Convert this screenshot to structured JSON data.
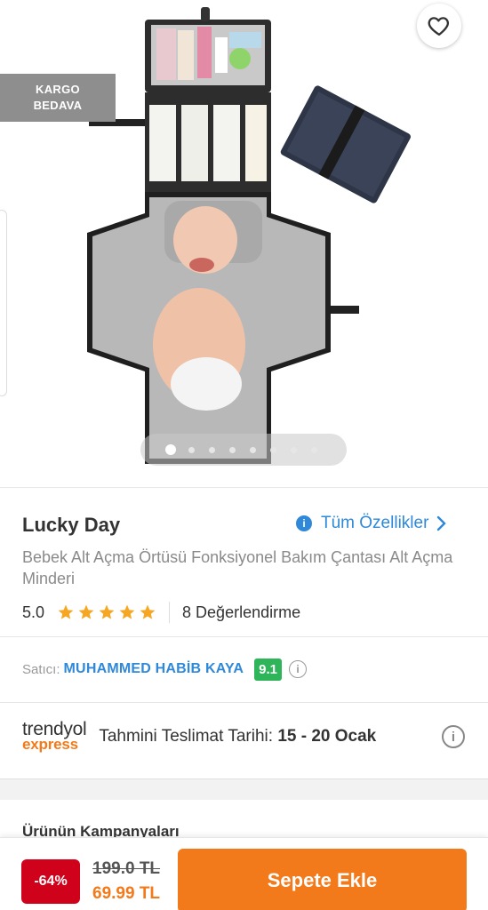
{
  "hero": {
    "cargo_badge": [
      "KARGO",
      "BEDAVA"
    ],
    "gallery": {
      "total_images": 8,
      "active_index": 0
    },
    "icons": {
      "back": "arrow-left-icon",
      "share": "share-icon",
      "favorite": "heart-icon"
    }
  },
  "product": {
    "brand": "Lucky Day",
    "all_features_label": "Tüm Özellikler",
    "title": "Bebek Alt Açma Örtüsü Fonksiyonel Bakım Çantası Alt Açma Minderi",
    "rating": "5.0",
    "stars": 5,
    "review_count": "8 Değerlendirme"
  },
  "seller": {
    "label": "Satıcı:",
    "name": "MUHAMMED HABİB KAYA",
    "score": "9.1"
  },
  "delivery": {
    "logo_line1": "trendyol",
    "logo_line2": "express",
    "label": "Tahmini Teslimat Tarihi:",
    "range": "15 - 20 Ocak"
  },
  "campaigns": {
    "title": "Ürünün Kampanyaları"
  },
  "bottom": {
    "discount": "-64%",
    "old_price": "199.0 TL",
    "new_price": "69.99 TL",
    "cart_label": "Sepete Ekle"
  },
  "colors": {
    "accent": "#f27a1a",
    "link": "#2f88d8",
    "discount": "#d0021b",
    "seller_score": "#2eb55a",
    "star": "#f5a623"
  }
}
